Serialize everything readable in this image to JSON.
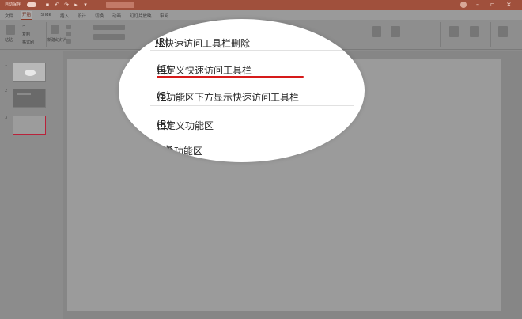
{
  "titlebar": {
    "autosave_label": "自动保存",
    "window_controls": [
      "minimize-icon",
      "restore-icon",
      "close-icon"
    ]
  },
  "ribbon_tabs": [
    "文件",
    "开始",
    "iSlide",
    "插入",
    "设计",
    "切换",
    "动画",
    "幻灯片放映",
    "审阅"
  ],
  "ribbon_groups": [
    "剪贴板",
    "幻灯片"
  ],
  "ribbon": {
    "new_slide": "新建幻灯片",
    "clipboard_items": [
      "粘贴",
      "复制",
      "格式刷"
    ]
  },
  "thumbnails": [
    {
      "number": "1"
    },
    {
      "number": "2"
    },
    {
      "number": "3"
    }
  ],
  "context_menu": {
    "items": [
      {
        "text": "从快速访问工具栏删除",
        "accel": "(R)"
      },
      {
        "text": "自定义快速访问工具栏",
        "accel": "(C)",
        "suffix": "..."
      },
      {
        "text": "在功能区下方显示快速访问工具栏",
        "accel": "(S)"
      },
      {
        "text": "自定义功能区",
        "accel": "(R)",
        "suffix": "..."
      },
      {
        "text": "折叠功能区",
        "accel": "(N)"
      }
    ]
  },
  "colors": {
    "titlebar": "#a0503c",
    "highlight_underline": "#d61a1a",
    "selected_thumb_border": "#b8223a"
  }
}
